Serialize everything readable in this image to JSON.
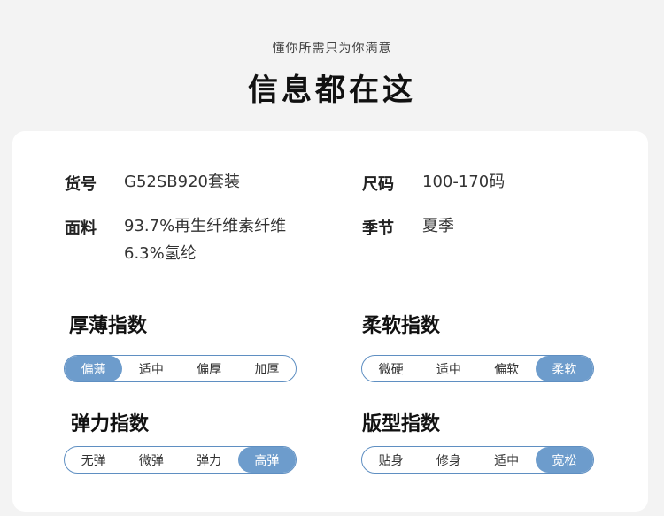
{
  "header": {
    "subtitle": "懂你所需只为你满意",
    "title": "信息都在这"
  },
  "info": {
    "item_no": {
      "label": "货号",
      "value": "G52SB920套装"
    },
    "size": {
      "label": "尺码",
      "value": "100-170码"
    },
    "fabric": {
      "label": "面料",
      "line1": "93.7%再生纤维素纤维",
      "line2": "6.3%氢纶"
    },
    "season": {
      "label": "季节",
      "value": "夏季"
    }
  },
  "indices": {
    "thickness": {
      "title": "厚薄指数",
      "options": [
        "偏薄",
        "适中",
        "偏厚",
        "加厚"
      ],
      "selected": "偏薄"
    },
    "softness": {
      "title": "柔软指数",
      "options": [
        "微硬",
        "适中",
        "偏软",
        "柔软"
      ],
      "selected": "柔软"
    },
    "elasticity": {
      "title": "弹力指数",
      "options": [
        "无弹",
        "微弹",
        "弹力",
        "高弹"
      ],
      "selected": "高弹"
    },
    "fit": {
      "title": "版型指数",
      "options": [
        "贴身",
        "修身",
        "适中",
        "宽松"
      ],
      "selected": "宽松"
    }
  },
  "colors": {
    "accent": "#6d9ccc",
    "border": "#5f8fc2"
  }
}
